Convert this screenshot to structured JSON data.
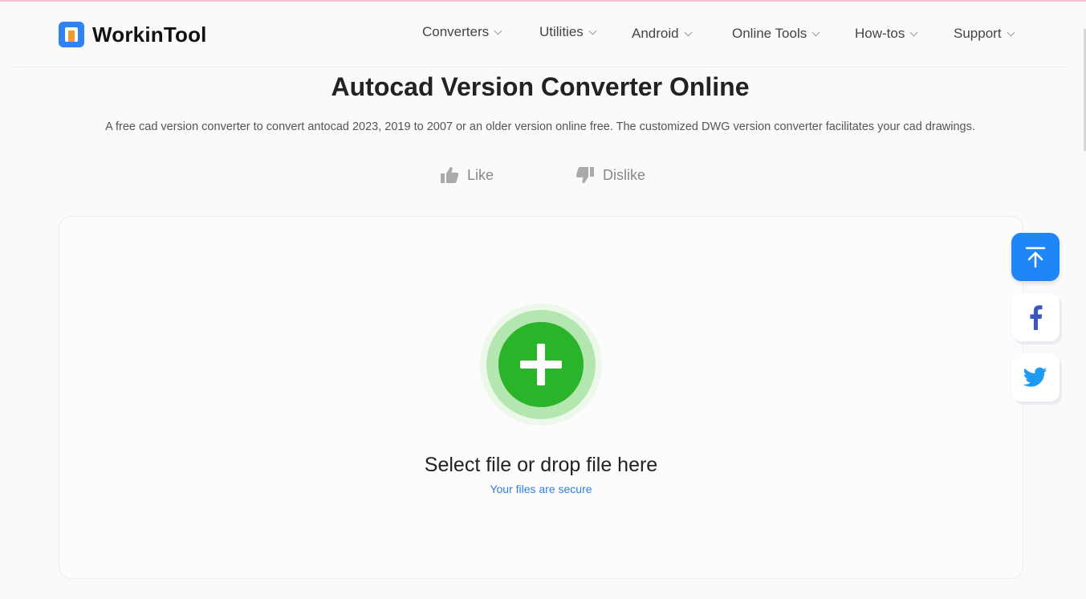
{
  "brand": {
    "name": "WorkinTool"
  },
  "nav": {
    "items": [
      {
        "label": "Converters"
      },
      {
        "label": "Utilities"
      },
      {
        "label": "Android"
      },
      {
        "label": "Online Tools"
      },
      {
        "label": "How-tos"
      },
      {
        "label": "Support"
      }
    ]
  },
  "page": {
    "title": "Autocad Version Converter Online",
    "subtitle": "A free cad version converter to convert antocad 2023, 2019 to 2007 or an older version online free. The customized DWG version converter facilitates your cad drawings."
  },
  "vote": {
    "like_label": "Like",
    "dislike_label": "Dislike"
  },
  "upload": {
    "title": "Select file or drop file here",
    "note": "Your files are secure"
  },
  "side_buttons": {
    "icons": [
      "arrow-up-to-top-icon",
      "facebook-icon",
      "twitter-icon"
    ]
  },
  "colors": {
    "accent_blue": "#1f86f7",
    "add_green": "#2fbd2f",
    "secure_link": "#2d7fe0",
    "facebook": "#3b57c4",
    "twitter": "#1d9bf0"
  }
}
